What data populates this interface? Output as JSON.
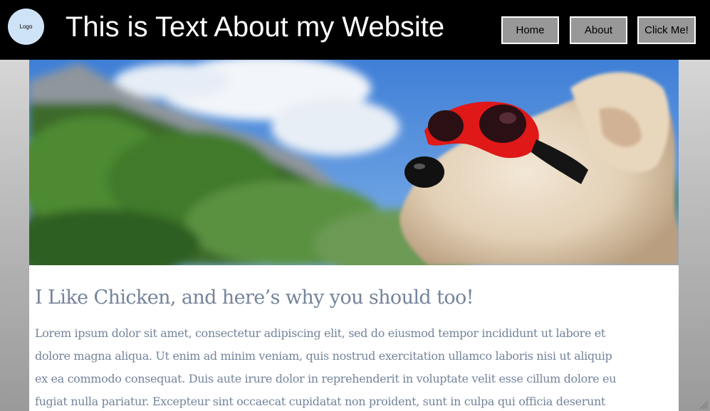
{
  "header": {
    "logo_label": "Logo",
    "title": "This is Text About my Website",
    "nav": {
      "home": "Home",
      "about": "About",
      "click": "Click Me!"
    }
  },
  "hero": {
    "image": "dog-with-red-goggles-photo"
  },
  "article": {
    "title": "I Like Chicken, and here’s why you should too!",
    "body_lines": [
      "Lorem ipsum dolor sit amet, consectetur adipiscing elit, sed do eiusmod tempor incididunt ut labore et",
      "dolore magna aliqua. Ut enim ad minim veniam, quis nostrud exercitation ullamco laboris nisi ut aliquip",
      "ex ea commodo consequat. Duis aute irure dolor in reprehenderit in voluptate velit esse cillum dolore eu",
      "fugiat nulla pariatur. Excepteur sint occaecat cupidatat non proident, sunt in culpa qui officia deserunt"
    ]
  },
  "colors": {
    "header_bg": "#000000",
    "nav_button_bg": "#989898",
    "article_text": "#74849b",
    "logo_bg": "#cfe3f7"
  }
}
